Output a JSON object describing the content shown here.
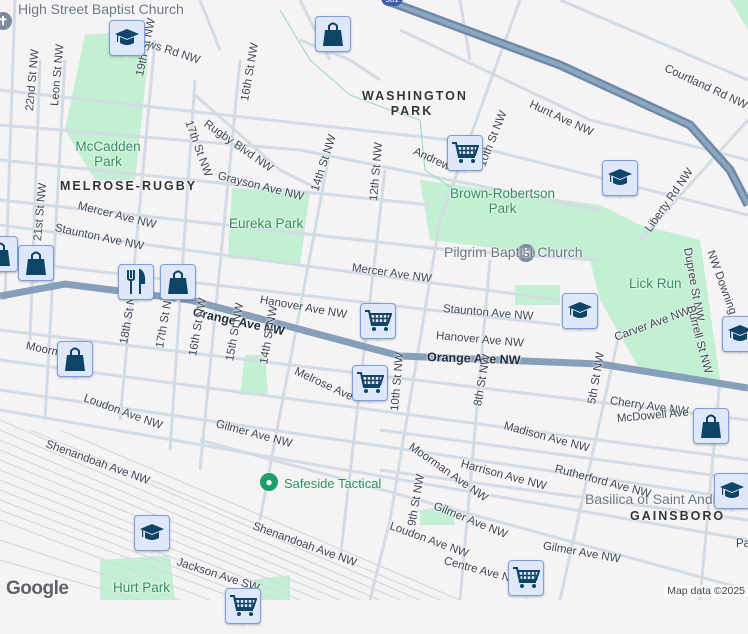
{
  "map": {
    "highway_shield": "581",
    "attribution": "Map data ©2025",
    "logo": "Google",
    "colors": {
      "background": "#f5f3f4",
      "park": "#c3efd2",
      "road": "#d3dbe4",
      "arterial": "#7f9ab8",
      "marker_fill": "#dfe8fb",
      "icon": "#0e4466"
    },
    "neighborhoods": [
      "MELROSE-RUGBY",
      "WASHINGTON PARK",
      "GAINSBORO"
    ],
    "parks": [
      "McCadden Park",
      "Eureka Park",
      "Brown-Robertson Park",
      "Lick Run",
      "Hurt Park"
    ],
    "places": [
      "High Street Baptist Church",
      "Pilgrim Baptist Church",
      "Safeside Tactical",
      "Basilica of Saint Andr"
    ],
    "streets": [
      "ws Rd NW",
      "19th St NW",
      "22nd St NW",
      "Leon St NW",
      "17th St NW",
      "Rugby Blvd NW",
      "16th St NW",
      "Grayson Ave NW",
      "14th St NW",
      "12th St NW",
      "Mercer Ave NW",
      "Staunton Ave NW",
      "21st St NW",
      "10th St NW",
      "Hunt Ave NW",
      "Courtland Rd NW",
      "Andrew",
      "Liberty Rd NW",
      "Mercer Ave NW",
      "Dupree St NW",
      "NW Downing S",
      "Hanover Ave NW",
      "Orange Ave NW",
      "Orange Ave NW",
      "Staunton Ave NW",
      "Hanover Ave NW",
      "Carver Ave NW",
      "Burrell St NW",
      "18th St NW",
      "17th St NW",
      "16th St NW",
      "15th St NW",
      "14th St NW",
      "Moorm",
      "Melrose Ave",
      "Loudon Ave NW",
      "Gilmer Ave NW",
      "Shenandoah Ave NW",
      "Shenandoah Ave NW",
      "Jackson Ave SW",
      "10th St NW",
      "8th St NW",
      "5th St NW",
      "Cherry Ave NW",
      "McDowell Ave",
      "Madison Ave NW",
      "Rutherford Ave NW",
      "Harrison Ave NW",
      "Moorman Ave NW",
      "9th St NW",
      "Gilmer Ave NW",
      "Loudon Ave NW",
      "Gilmer Ave NW",
      "Centre Ave NW",
      "Pa"
    ],
    "markers": [
      {
        "type": "school-icon"
      },
      {
        "type": "shopping-bag-icon"
      },
      {
        "type": "shopping-cart-icon"
      },
      {
        "type": "school-icon"
      },
      {
        "type": "shopping-bag-icon"
      },
      {
        "type": "shopping-bag-icon"
      },
      {
        "type": "restaurant-icon"
      },
      {
        "type": "shopping-bag-icon"
      },
      {
        "type": "shopping-cart-icon"
      },
      {
        "type": "school-icon"
      },
      {
        "type": "school-icon"
      },
      {
        "type": "shopping-bag-icon"
      },
      {
        "type": "shopping-cart-icon"
      },
      {
        "type": "shopping-bag-icon"
      },
      {
        "type": "school-icon"
      },
      {
        "type": "school-icon"
      },
      {
        "type": "shopping-cart-icon"
      },
      {
        "type": "shopping-cart-icon"
      }
    ]
  }
}
